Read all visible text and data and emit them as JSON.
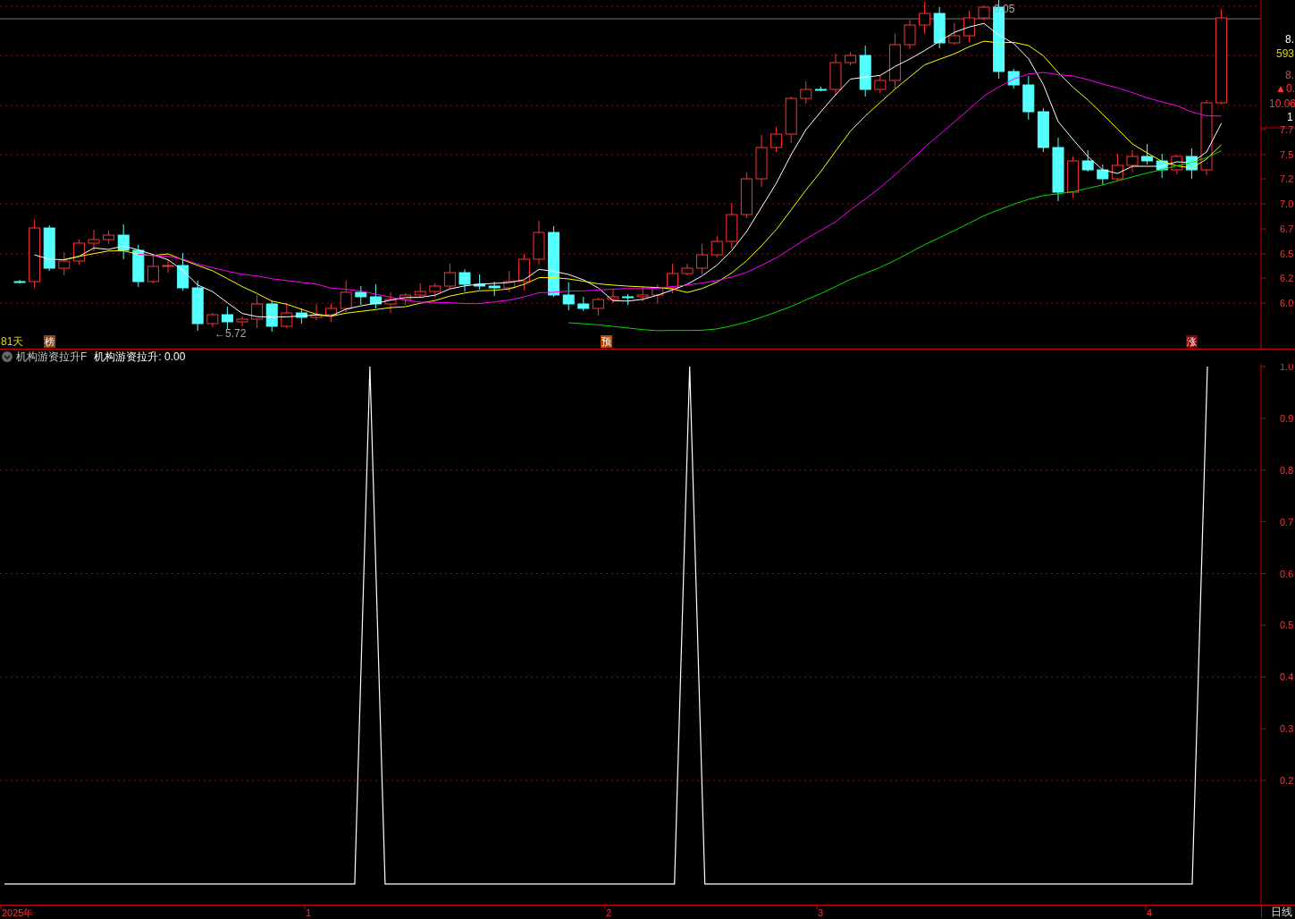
{
  "price_chart": {
    "period_label": "81天",
    "low_label": "←5.72",
    "high_label": "9.05",
    "markers": [
      {
        "text": "榜",
        "color": "#8b4513"
      },
      {
        "text": "预",
        "color": "#b34700"
      },
      {
        "text": "涨",
        "color": "#8b0000"
      }
    ]
  },
  "price_axis": {
    "info": [
      {
        "text": "8.",
        "color": "#ffffff"
      },
      {
        "text": "593",
        "color": "#d8d800"
      },
      {
        "text": "8.",
        "color": "#ff3232"
      },
      {
        "text": "▲0.",
        "color": "#ff3232"
      },
      {
        "text": "10.06",
        "color": "#ff3232"
      },
      {
        "text": "1",
        "color": "#ffffff"
      }
    ],
    "ticks": [
      "7.7",
      "7.5",
      "7.2",
      "7.0",
      "6.7",
      "6.5",
      "6.2",
      "6.0"
    ]
  },
  "indicator": {
    "title": "机构游资拉升F",
    "value": ": 0.00",
    "chart_data": {
      "type": "line",
      "ylim": [
        -0.066,
        1
      ],
      "grid": true,
      "yticks": [
        {
          "value": 1,
          "label": "1.0"
        },
        {
          "value": 0.9,
          "label": "0.9"
        },
        {
          "value": 0.8,
          "label": "0.8"
        },
        {
          "value": 0.7,
          "label": "0.7"
        },
        {
          "value": 0.6,
          "label": "0.6"
        },
        {
          "value": 0.5,
          "label": "0.5"
        },
        {
          "value": 0.4,
          "label": "0.4"
        },
        {
          "value": 0.3,
          "label": "0.3"
        },
        {
          "value": 0.2,
          "label": "0.2"
        }
      ],
      "series": [
        {
          "name": "机构游资拉升",
          "color": "#ffffff",
          "values": [
            0,
            0,
            0,
            0,
            0,
            0,
            0,
            0,
            0,
            0,
            0,
            0,
            0,
            0,
            0,
            0,
            0,
            0,
            0,
            0,
            0,
            0,
            0,
            0,
            1,
            0,
            0,
            0,
            0,
            0,
            0,
            0,
            0,
            0,
            0,
            0,
            0,
            0,
            0,
            0,
            0,
            0,
            0,
            0,
            0,
            1,
            0,
            0,
            0,
            0,
            0,
            0,
            0,
            0,
            0,
            0,
            0,
            0,
            0,
            0,
            0,
            0,
            0,
            0,
            0,
            0,
            0,
            0,
            0,
            0,
            0,
            0,
            0,
            0,
            0,
            0,
            0,
            0,
            0,
            1
          ]
        }
      ]
    }
  },
  "time_axis": {
    "labels": [
      "2025年",
      "1",
      "2",
      "3",
      "4"
    ]
  },
  "period": "日线"
}
